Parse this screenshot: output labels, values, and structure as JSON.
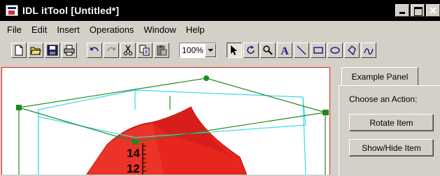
{
  "window": {
    "title": "IDL itTool [Untitled*]",
    "close_glyph": "✕"
  },
  "menu": [
    "File",
    "Edit",
    "Insert",
    "Operations",
    "Window",
    "Help"
  ],
  "toolbar": {
    "zoom_value": "100%",
    "icons": {
      "file": [
        "new-file-icon",
        "open-folder-icon",
        "save-disk-icon",
        "print-icon"
      ],
      "edit": [
        "undo-icon",
        "redo-icon",
        "cut-icon",
        "copy-icon",
        "paste-icon"
      ],
      "tools": [
        "select-arrow-icon",
        "rotate-icon",
        "zoom-magnifier-icon",
        "text-icon",
        "line-icon",
        "rectangle-icon",
        "oval-icon",
        "polygon-icon",
        "freehand-icon"
      ]
    },
    "selected_tool": "select-arrow-icon",
    "text_tool_glyph": "A"
  },
  "canvas": {
    "border_color": "#e02020",
    "axis_ticks": [
      "14",
      "12"
    ],
    "surface_color": "#e8261e",
    "bounding_box_color": "#1f8a1f",
    "axis_box_color": "#3ad8e8"
  },
  "panel": {
    "tab_label": "Example Panel",
    "prompt": "Choose an Action:",
    "rotate_button": "Rotate Item",
    "show_hide_button": "Show/Hide Item"
  }
}
